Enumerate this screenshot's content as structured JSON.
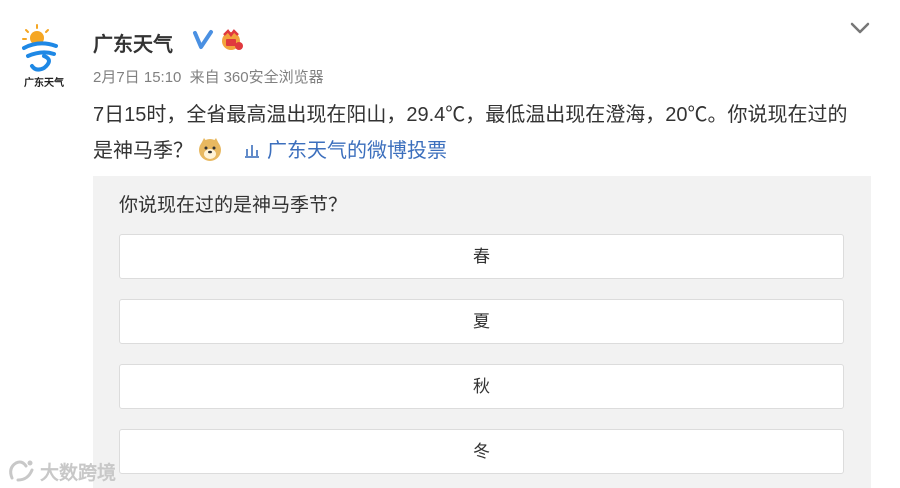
{
  "account": {
    "avatar_caption": "广东天气",
    "username": "广东天气"
  },
  "meta": {
    "date_time": "2月7日 15:10",
    "source_prefix": "来自",
    "source": "360安全浏览器"
  },
  "post": {
    "text": "7日15时，全省最高温出现在阳山，29.4℃，最低温出现在澄海，20℃。你说现在过的是神马季？",
    "vote_link": "广东天气的微博投票"
  },
  "poll": {
    "question": "你说现在过的是神马季节？",
    "options": [
      "春",
      "夏",
      "秋",
      "冬"
    ]
  },
  "watermark": {
    "text": "大数跨境"
  },
  "colors": {
    "link": "#3c6fbd",
    "verified": "#4a90e2",
    "meta": "#808080",
    "poll_bg": "#f2f2f2"
  },
  "icons": {
    "verified": "verified-icon",
    "vip": "vip-badge-icon",
    "expand": "chevron-down-icon",
    "emoji": "doge-emoji-icon",
    "vote": "vote-chart-icon"
  }
}
